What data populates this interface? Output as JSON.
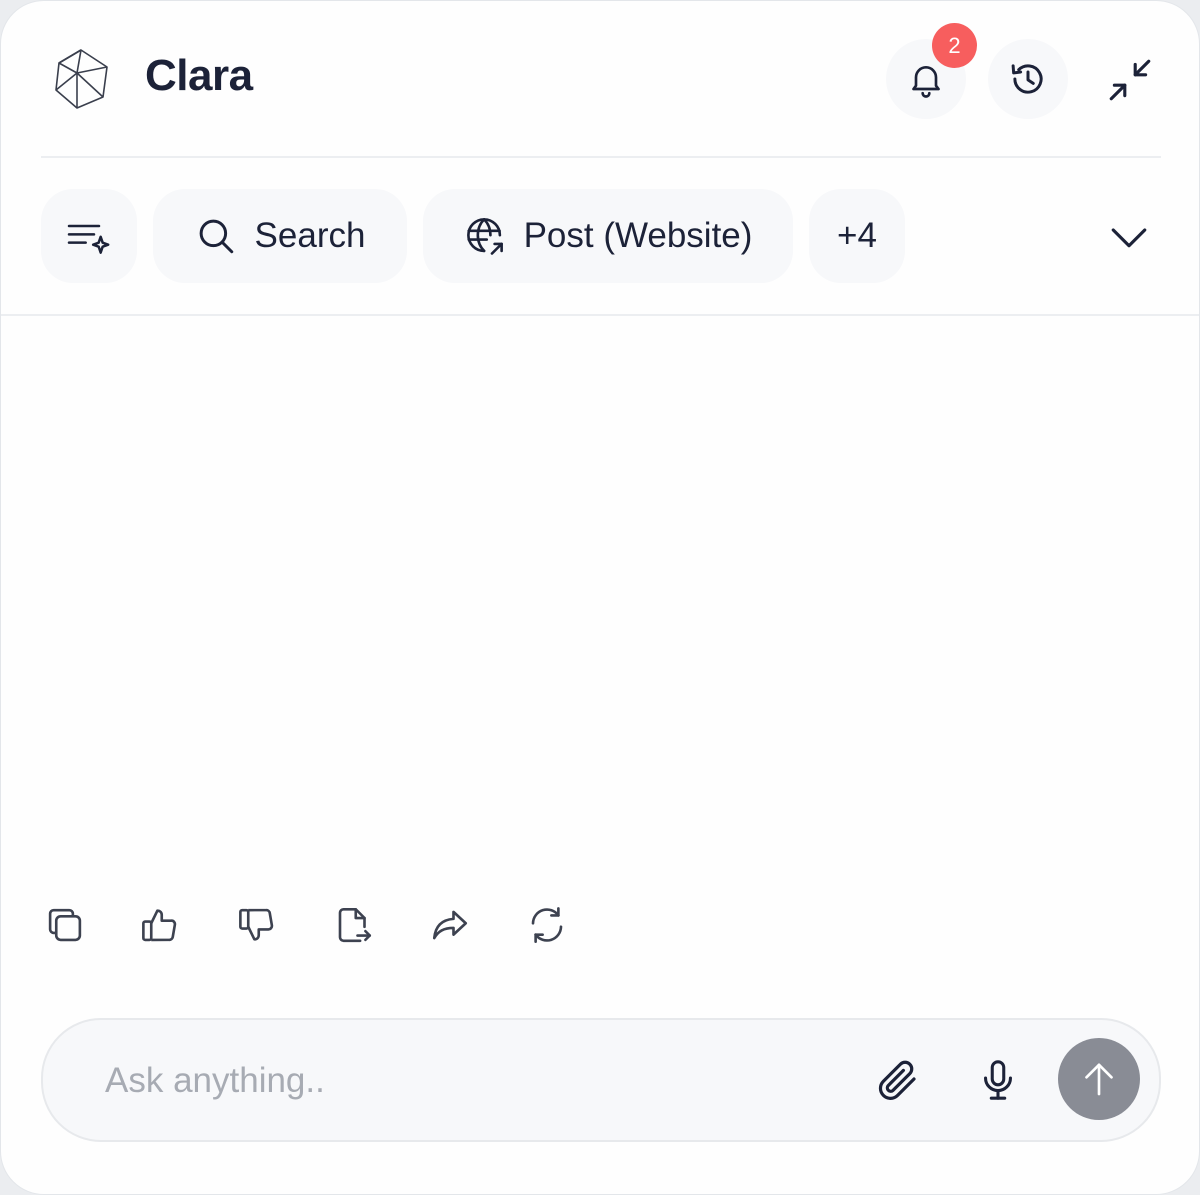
{
  "header": {
    "title": "Clara",
    "logo_icon": "polyhedron-logo-icon",
    "notification_count": "2",
    "bell_icon": "bell-icon",
    "history_icon": "history-icon",
    "minimize_icon": "minimize-icon"
  },
  "toolbar": {
    "chips": [
      {
        "icon": "filter-sparkle-icon",
        "label": ""
      },
      {
        "icon": "search-icon",
        "label": "Search"
      },
      {
        "icon": "globe-share-icon",
        "label": "Post (Website)"
      },
      {
        "icon": "",
        "label": "+4"
      }
    ],
    "expand_icon": "chevron-down-icon"
  },
  "message_actions": [
    {
      "icon": "copy-icon"
    },
    {
      "icon": "thumbs-up-icon"
    },
    {
      "icon": "thumbs-down-icon"
    },
    {
      "icon": "export-document-icon"
    },
    {
      "icon": "share-icon"
    },
    {
      "icon": "regenerate-icon"
    }
  ],
  "composer": {
    "placeholder": "Ask anything..",
    "value": "",
    "attach_icon": "paperclip-icon",
    "mic_icon": "microphone-icon",
    "send_icon": "arrow-up-icon"
  },
  "colors": {
    "text": "#1c2238",
    "badge": "#f75e5e",
    "send_button": "#898c95",
    "chip_background": "#f7f8fa"
  }
}
